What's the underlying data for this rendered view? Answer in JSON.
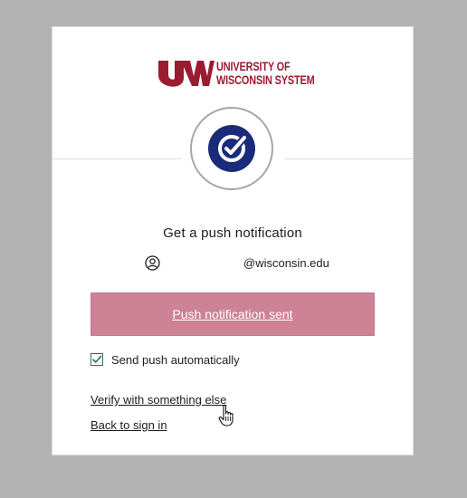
{
  "brand": {
    "name_line1": "UNIVERSITY OF",
    "name_line2": "WISCONSIN SYSTEM",
    "color": "#9b1c31"
  },
  "authenticator": {
    "icon": "okta-verify-check-icon",
    "color": "#1a2b7a"
  },
  "challenge": {
    "title": "Get a push notification",
    "identifier_suffix": "@wisconsin.edu",
    "user_icon": "user-circle-icon"
  },
  "push_button": {
    "label": "Push notification sent",
    "color": "#cd8296"
  },
  "auto_push": {
    "label": "Send push automatically",
    "checked": true,
    "check_color": "#2e6f5a"
  },
  "links": {
    "verify_other": "Verify with something else",
    "back_to_signin": "Back to sign in"
  }
}
